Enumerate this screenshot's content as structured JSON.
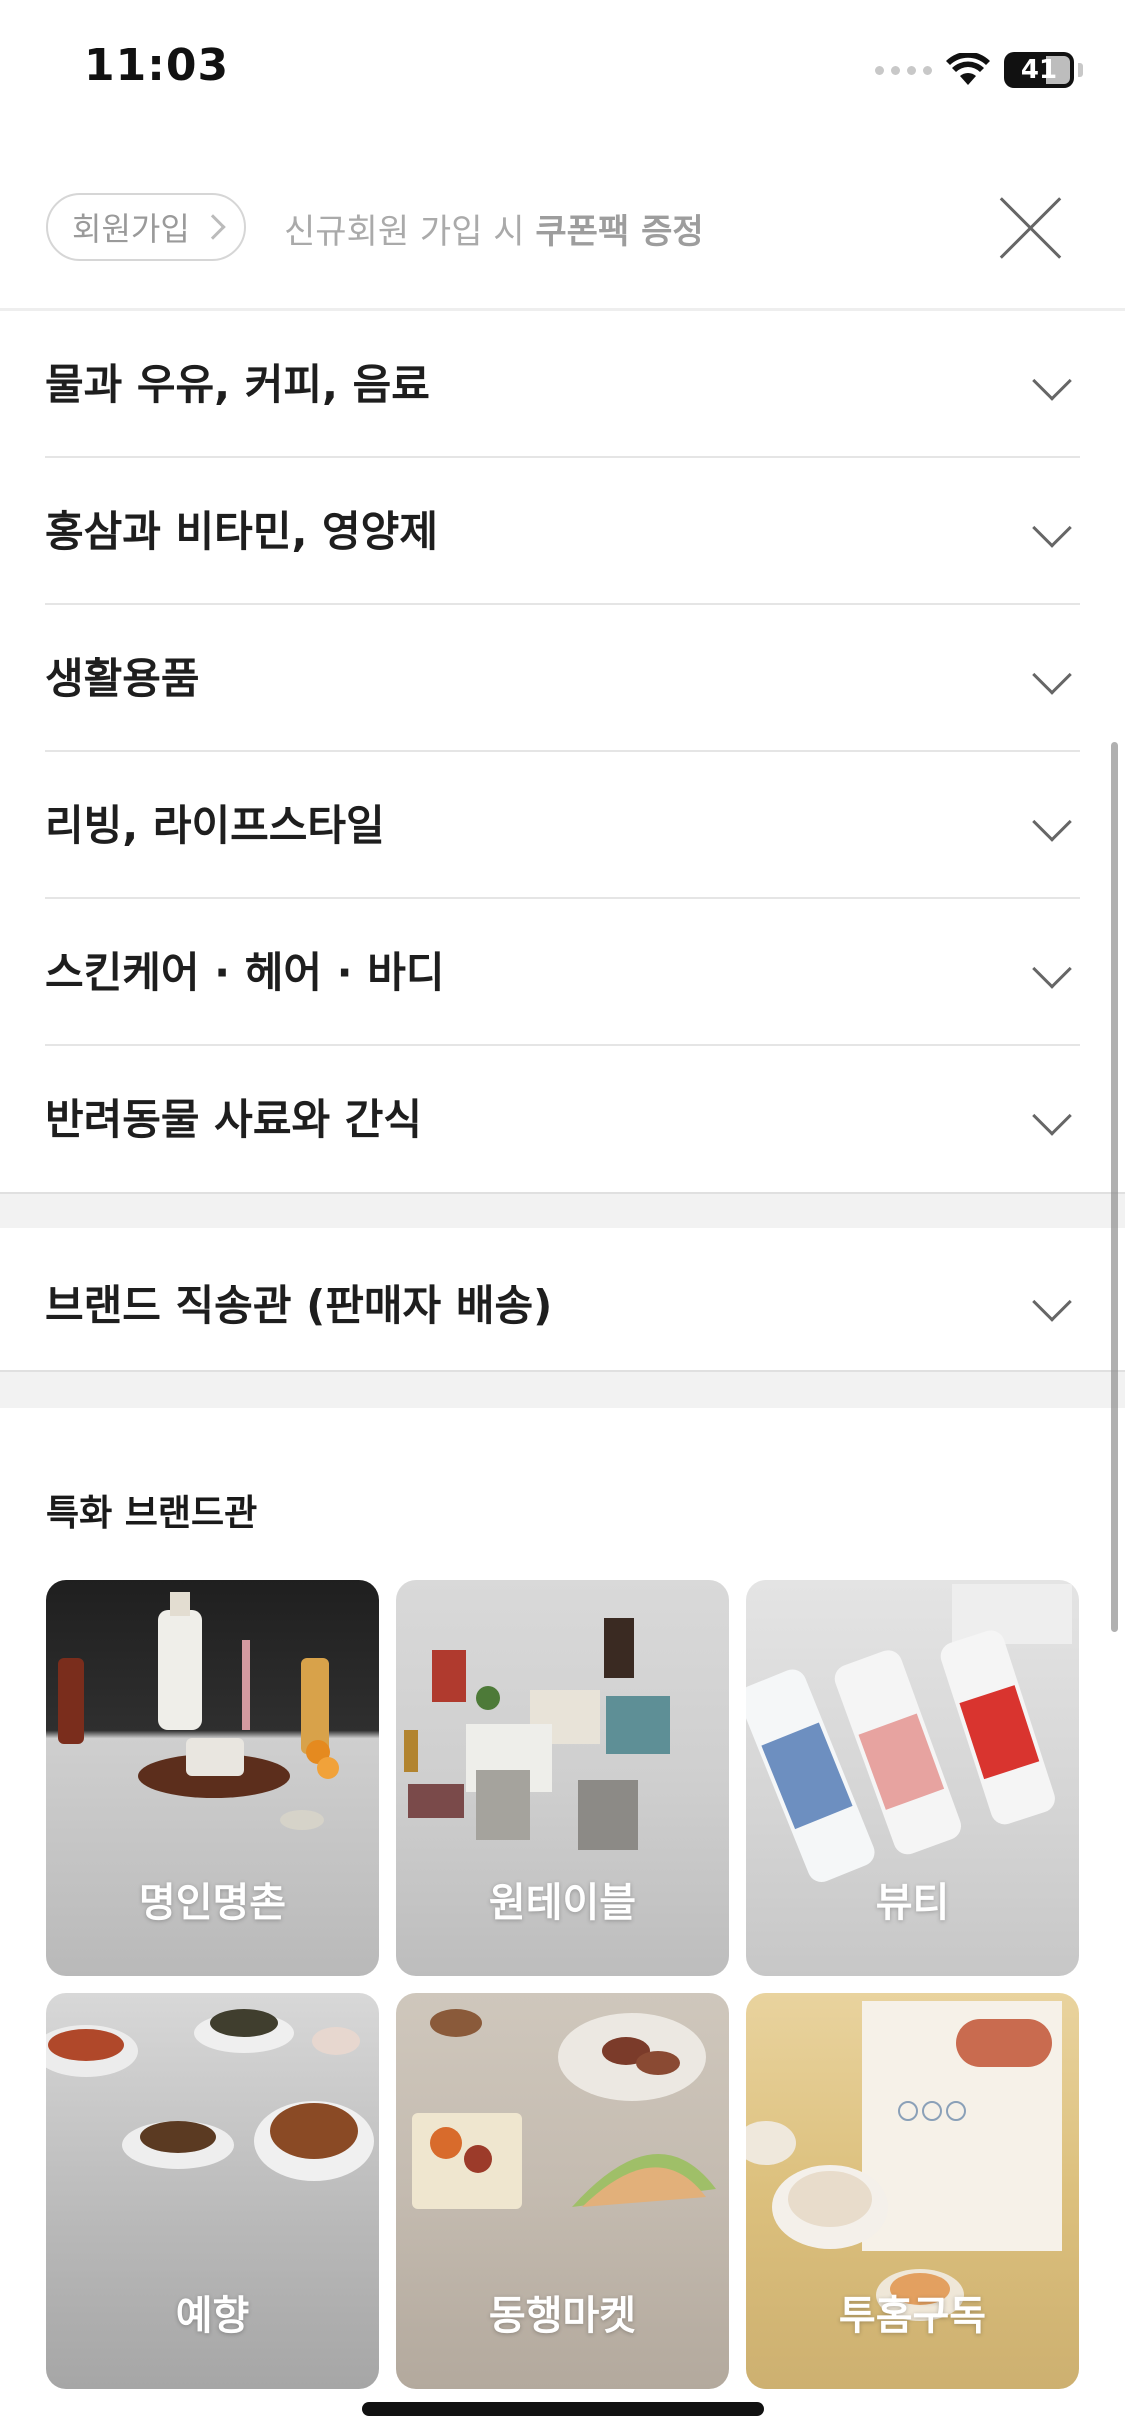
{
  "status_bar": {
    "time": "11:03",
    "battery": "41"
  },
  "signup": {
    "button_label": "회원가입",
    "promo_prefix": "신규회원 가입 시 ",
    "promo_highlight": "쿠폰팩 증정"
  },
  "categories": [
    {
      "label": "물과 우유, 커피, 음료"
    },
    {
      "label": "홍삼과 비타민, 영양제"
    },
    {
      "label": "생활용품"
    },
    {
      "label": "리빙, 라이프스타일"
    },
    {
      "label": "스킨케어 · 헤어 · 바디"
    },
    {
      "label": "반려동물 사료와 간식"
    }
  ],
  "brand_direct": {
    "label": "브랜드 직송관 (판매자 배송)"
  },
  "special_brands": {
    "title": "특화 브랜드관",
    "items": [
      {
        "label": "명인명촌"
      },
      {
        "label": "원테이블"
      },
      {
        "label": "뷰티"
      },
      {
        "label": "예향"
      },
      {
        "label": "동행마켓"
      },
      {
        "label": "투홈구독"
      }
    ]
  }
}
